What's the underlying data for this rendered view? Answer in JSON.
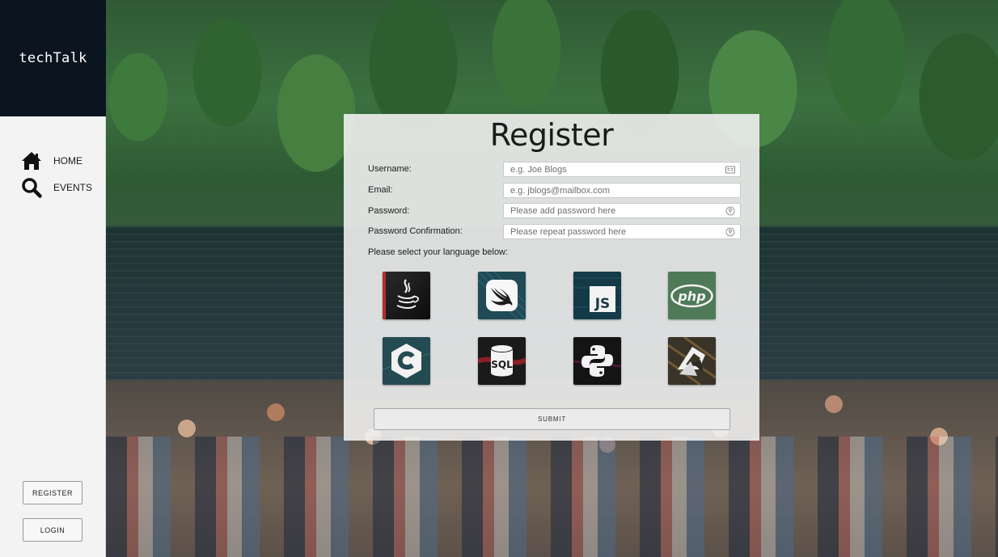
{
  "sidebar": {
    "logo": "techTalk",
    "nav": [
      {
        "label": "HOME",
        "icon": "home-icon"
      },
      {
        "label": "EVENTS",
        "icon": "search-icon"
      }
    ],
    "register_label": "REGISTER",
    "login_label": "LOGIN"
  },
  "form": {
    "title": "Register",
    "fields": [
      {
        "label": "Username:",
        "placeholder": "e.g. Joe Blogs",
        "value": ""
      },
      {
        "label": "Email:",
        "placeholder": "e.g. jblogs@mailbox.com",
        "value": ""
      },
      {
        "label": "Password:",
        "placeholder": "Please add password here",
        "value": ""
      },
      {
        "label": "Password Confirmation:",
        "placeholder": "Please repeat password here",
        "value": ""
      }
    ],
    "language_prompt": "Please select your language below:",
    "languages": [
      {
        "name": "java-icon",
        "label": "Java"
      },
      {
        "name": "swift-icon",
        "label": "Swift"
      },
      {
        "name": "javascript-icon",
        "label": "JS"
      },
      {
        "name": "php-icon",
        "label": "php"
      },
      {
        "name": "c-icon",
        "label": "C"
      },
      {
        "name": "sql-icon",
        "label": "SQL"
      },
      {
        "name": "python-icon",
        "label": "Python"
      },
      {
        "name": "kotlin-icon",
        "label": "Kotlin"
      }
    ],
    "submit_label": "SUBMIT"
  },
  "colors": {
    "sidebar_bg": "#f3f3f3",
    "logo_bg": "#0b1520",
    "panel_bg": "#f0f0f0"
  }
}
